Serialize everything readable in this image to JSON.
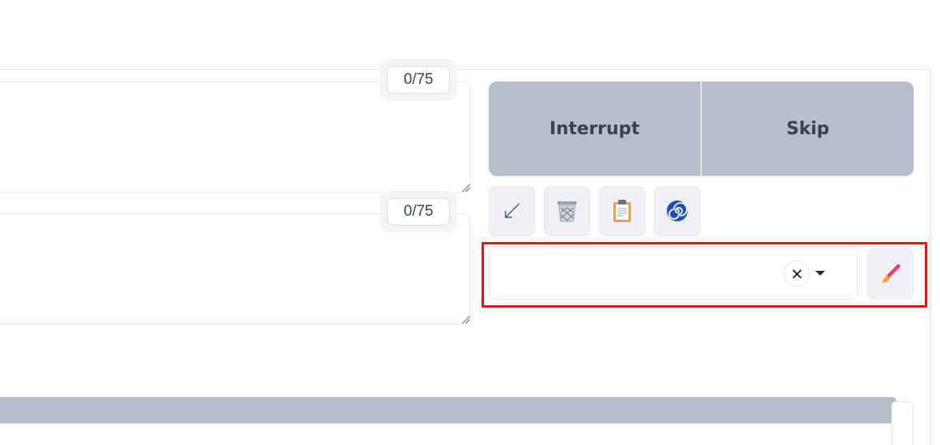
{
  "prompts": {
    "positive": {
      "token_count": "0/75",
      "value": ""
    },
    "negative": {
      "token_count": "0/75",
      "value": ""
    }
  },
  "actions": {
    "interrupt_label": "Interrupt",
    "skip_label": "Skip"
  },
  "tools": [
    {
      "icon": "arrow-down-left-icon"
    },
    {
      "icon": "trash-bin-icon"
    },
    {
      "icon": "clipboard-icon"
    },
    {
      "icon": "spiral-icon"
    }
  ],
  "styles": {
    "selected": "",
    "apply_icon": "paintbrush-icon"
  },
  "colors": {
    "button_bg": "#b4bfca",
    "button_text": "#374151",
    "highlight": "#ee1111"
  }
}
